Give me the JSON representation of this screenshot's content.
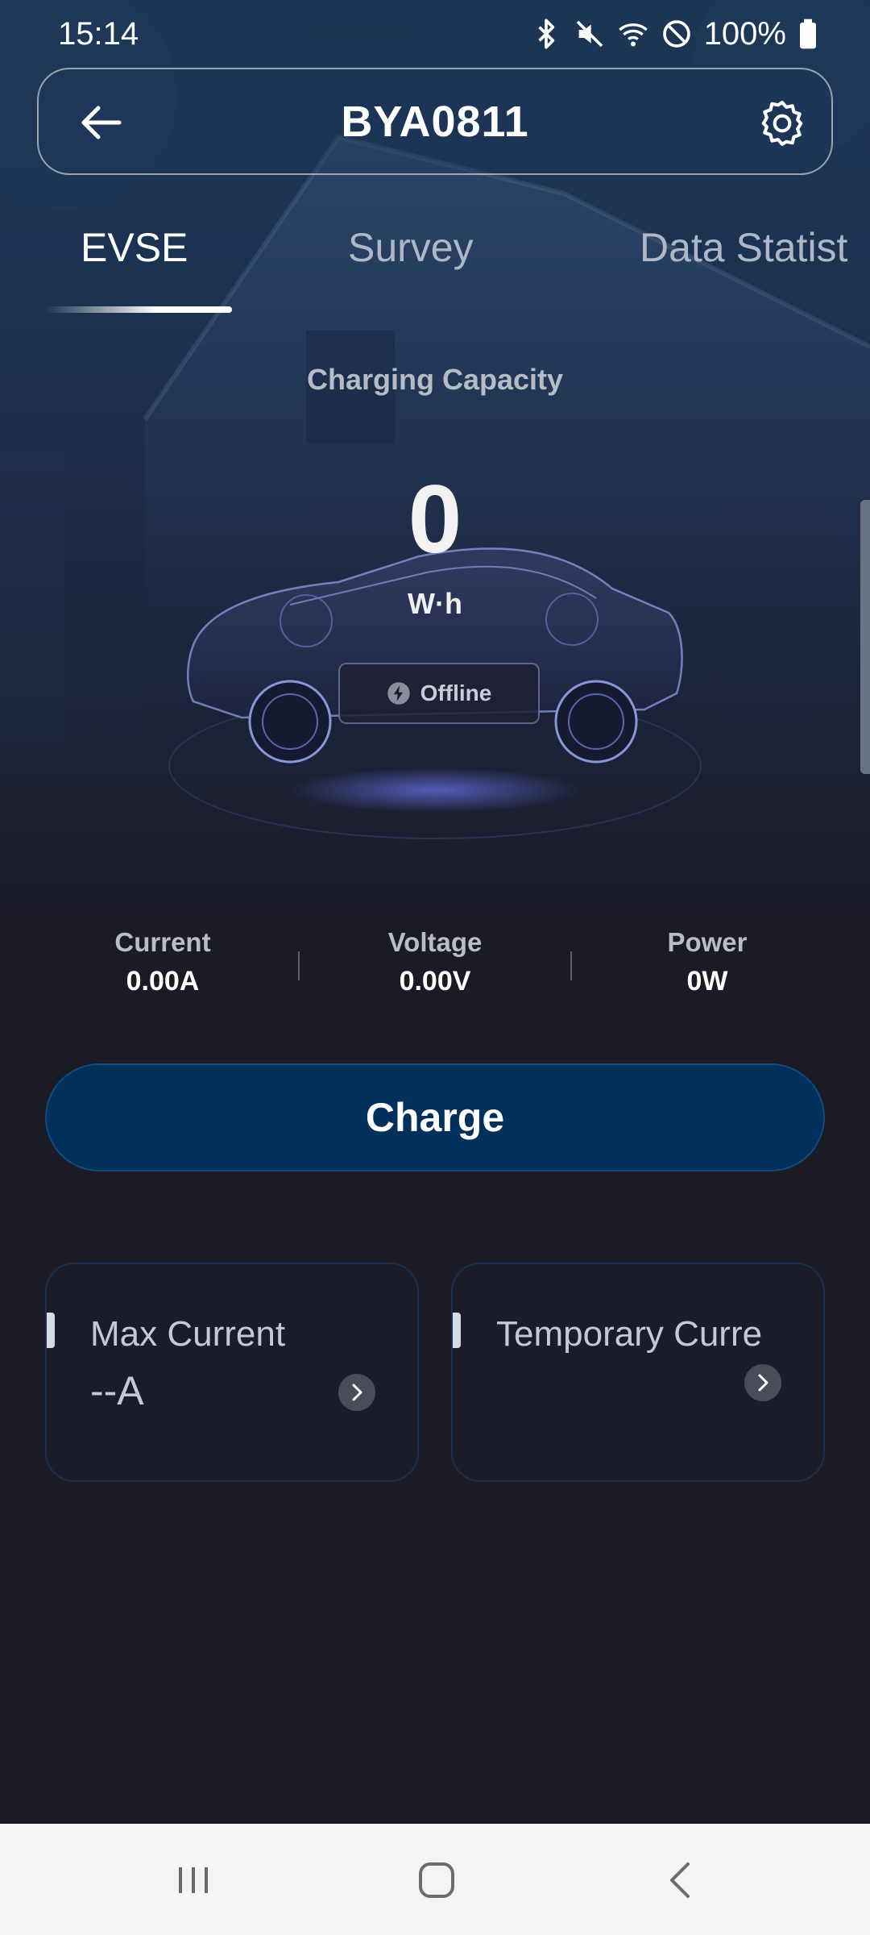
{
  "status_bar": {
    "time": "15:14",
    "battery_text": "100%",
    "icons": [
      "bluetooth-icon",
      "mute-icon",
      "wifi-icon",
      "do-not-disturb-icon",
      "battery-icon"
    ]
  },
  "header": {
    "title": "BYA0811",
    "back_icon": "arrow-left-icon",
    "settings_icon": "gear-icon"
  },
  "tabs": [
    {
      "label": "EVSE",
      "active": true
    },
    {
      "label": "Survey",
      "active": false
    },
    {
      "label": "Data Statist",
      "active": false
    }
  ],
  "capacity": {
    "label": "Charging Capacity",
    "value": "0",
    "unit": "W·h",
    "status": "Offline"
  },
  "metrics": [
    {
      "label": "Current",
      "value": "0.00A"
    },
    {
      "label": "Voltage",
      "value": "0.00V"
    },
    {
      "label": "Power",
      "value": "0W"
    }
  ],
  "charge_button": {
    "label": "Charge"
  },
  "cards": [
    {
      "title": "Max Current",
      "value": "--A"
    },
    {
      "title": "Temporary Curre",
      "value": ""
    }
  ],
  "colors": {
    "accent_button": "#01305a",
    "background": "#1b1b26",
    "header_bg": "#1d3655"
  }
}
